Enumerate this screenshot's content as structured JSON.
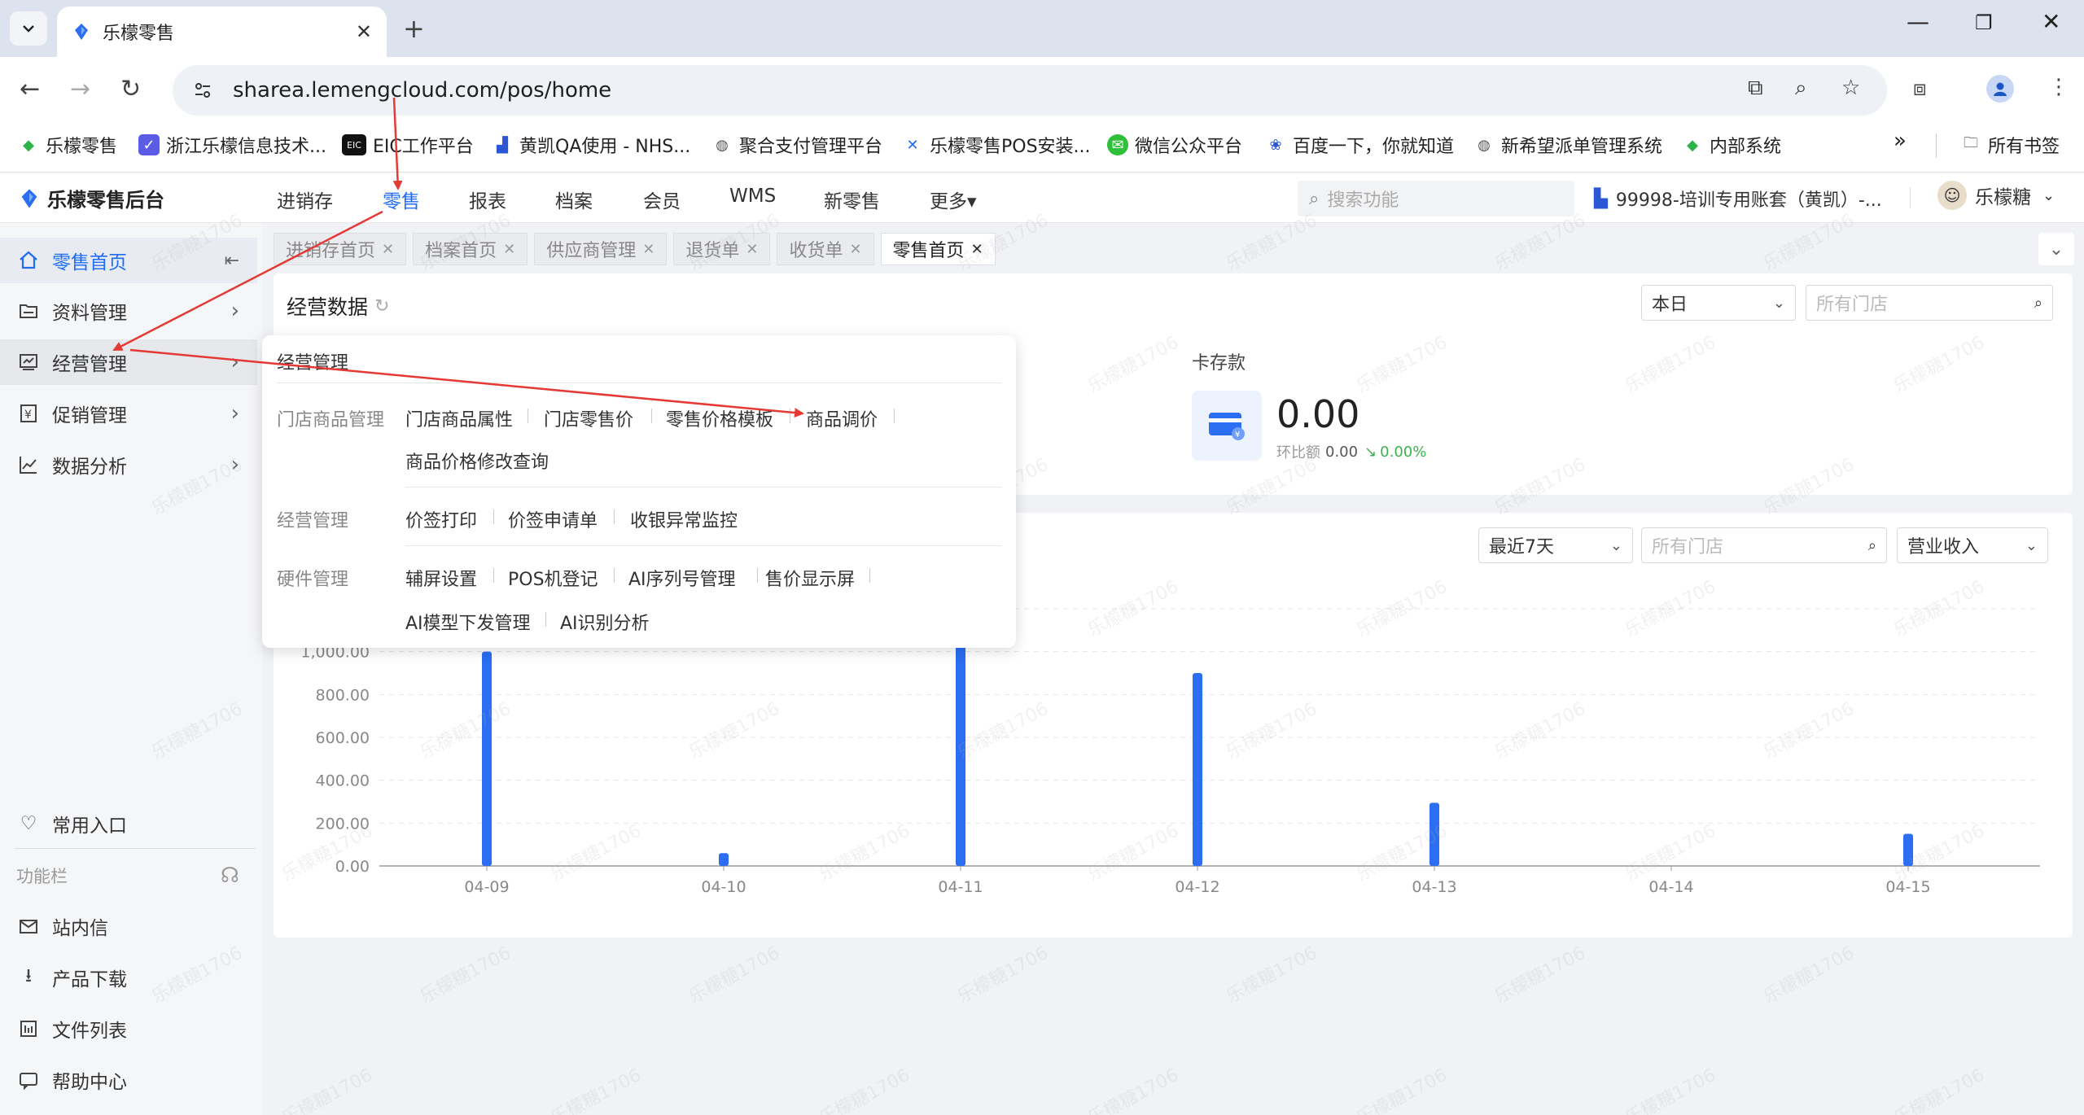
{
  "browser": {
    "tab_title": "乐檬零售",
    "url": "sharea.lemengcloud.com/pos/home",
    "bookmarks": [
      "乐檬零售",
      "浙江乐檬信息技术...",
      "EIC工作平台",
      "黄凯QA使用 - NHS...",
      "聚合支付管理平台",
      "乐檬零售POS安装...",
      "微信公众平台",
      "百度一下，你就知道",
      "新希望派单管理系统",
      "内部系统"
    ],
    "all_bookmarks": "所有书签",
    "more": "»"
  },
  "header": {
    "app_name": "乐檬零售后台",
    "nav": [
      "进销存",
      "零售",
      "报表",
      "档案",
      "会员",
      "WMS",
      "新零售",
      "更多▾"
    ],
    "search_placeholder": "搜索功能",
    "account": "99998-培训专用账套（黄凯）-...",
    "user": "乐檬糖"
  },
  "sidebar": {
    "items": [
      {
        "label": "零售首页",
        "icon": "home-icon"
      },
      {
        "label": "资料管理",
        "icon": "folder-icon"
      },
      {
        "label": "经营管理",
        "icon": "monitor-icon"
      },
      {
        "label": "促销管理",
        "icon": "promo-icon"
      },
      {
        "label": "数据分析",
        "icon": "chart-icon"
      }
    ],
    "favorites": "常用入口",
    "function_bar": "功能栏",
    "tools": [
      "站内信",
      "产品下载",
      "文件列表",
      "帮助中心"
    ]
  },
  "page_tabs": [
    "进销存首页",
    "档案首页",
    "供应商管理",
    "退货单",
    "收货单",
    "零售首页"
  ],
  "business_data": {
    "title": "经营数据",
    "period": "本日",
    "store_placeholder": "所有门店",
    "card_deposit_label": "卡存款",
    "card_deposit_value": "0.00",
    "ratio_label": "环比额",
    "ratio_value": "0.00",
    "ratio_pct": "0.00%"
  },
  "chart_panel": {
    "period": "最近7天",
    "store_placeholder": "所有门店",
    "metric": "营业收入"
  },
  "chart_data": {
    "type": "bar",
    "categories": [
      "04-09",
      "04-10",
      "04-11",
      "04-12",
      "04-13",
      "04-14",
      "04-15"
    ],
    "values": [
      1000,
      60,
      1150,
      900,
      295,
      0,
      150
    ],
    "ylim": [
      0,
      1200
    ],
    "yticks": [
      "0.00",
      "200.00",
      "400.00",
      "600.00",
      "800.00",
      "1,000.00"
    ],
    "title": "",
    "xlabel": "",
    "ylabel": "",
    "color": "#2b6ef2"
  },
  "dropdown": {
    "title": "经营管理",
    "groups": [
      {
        "label": "门店商品管理",
        "items": [
          "门店商品属性",
          "门店零售价",
          "零售价格模板",
          "商品调价",
          "商品价格修改查询"
        ]
      },
      {
        "label": "经营管理",
        "items": [
          "价签打印",
          "价签申请单",
          "收银异常监控"
        ]
      },
      {
        "label": "硬件管理",
        "items": [
          "辅屏设置",
          "POS机登记",
          "AI序列号管理",
          "售价显示屏",
          "AI模型下发管理",
          "AI识别分析"
        ]
      }
    ]
  },
  "watermark": "乐檬糖1706",
  "colors": {
    "accent": "#1f6cf5",
    "annotation": "#e53935",
    "bar": "#2b6ef2"
  }
}
